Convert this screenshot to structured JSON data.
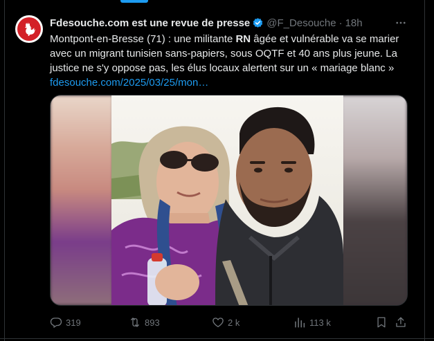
{
  "tweet": {
    "display_name": "Fdesouche.com est une revue de presse",
    "handle": "@F_Desouche",
    "separator": "·",
    "time": "18h",
    "text_before_bold": "Montpont-en-Bresse (71) : une militante ",
    "text_bold": "RN",
    "text_after_bold": " âgée et vulnérable va se marier avec un migrant tunisien sans-papiers, sous OQTF et 40 ans plus jeune. La justice ne s'y oppose pas, les élus locaux alertent sur un « mariage blanc »",
    "link": "fdesouche.com/2025/03/25/mon…"
  },
  "actions": {
    "replies": "319",
    "reposts": "893",
    "likes": "2 k",
    "views": "113 k"
  },
  "icons": {
    "avatar": "rooster-icon",
    "verified": "verified-badge-icon",
    "more": "more-dots-icon",
    "reply": "reply-icon",
    "repost": "repost-icon",
    "like": "heart-icon",
    "views": "views-chart-icon",
    "bookmark": "bookmark-icon",
    "share": "share-icon"
  },
  "colors": {
    "accent": "#1d9bf0",
    "text": "#e7e9ea",
    "muted": "#71767b",
    "background": "#000000",
    "avatar_red": "#d32027"
  }
}
